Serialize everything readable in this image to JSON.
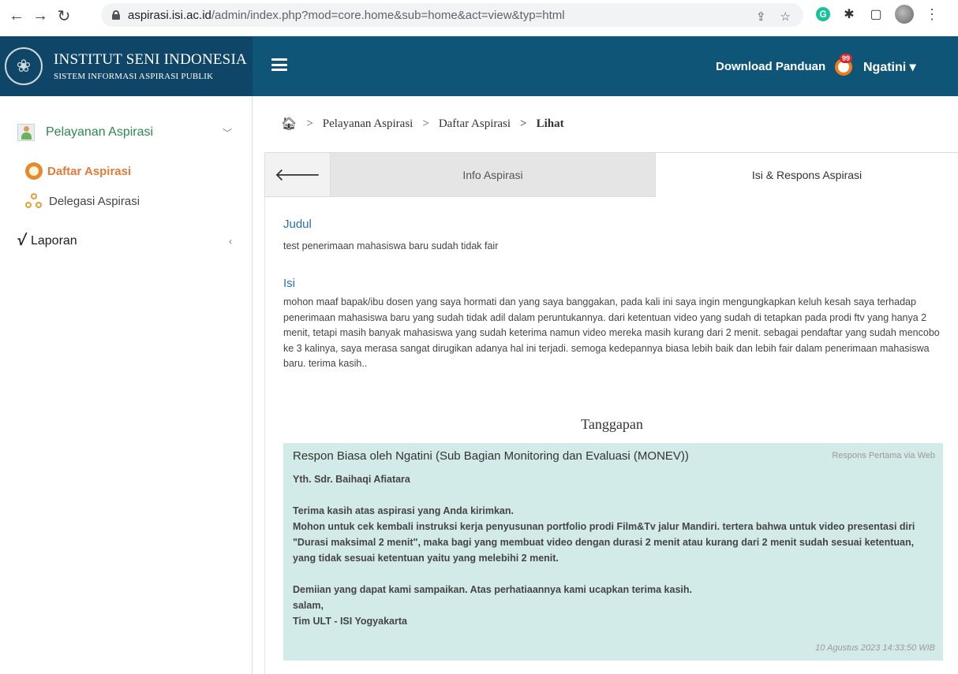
{
  "browser": {
    "url_host": "aspirasi.isi.ac.id",
    "url_path": "/admin/index.php?mod=core.home&sub=home&act=view&typ=html",
    "icons": [
      "back-icon",
      "forward-icon",
      "reload-icon",
      "lock-icon",
      "share-icon",
      "star-icon",
      "grammarly-icon",
      "extensions-icon",
      "sidepanel-icon",
      "profile-avatar",
      "menu-icon"
    ]
  },
  "brand": {
    "title": "INSTITUT SENI INDONESIA",
    "subtitle": "SISTEM INFORMASI ASPIRASI PUBLIK"
  },
  "topbar": {
    "download_label": "Download Panduan",
    "notif_count": "99",
    "user_name": "Ngatini ▾"
  },
  "sidebar": {
    "group1": "Pelayanan Aspirasi",
    "item_active": "Daftar Aspirasi",
    "item2": "Delegasi Aspirasi",
    "group2": "Laporan"
  },
  "breadcrumb": {
    "item1": "Pelayanan Aspirasi",
    "item2": "Daftar Aspirasi",
    "current": "Lihat"
  },
  "tabs": {
    "info": "Info Aspirasi",
    "isi": "Isi & Respons Aspirasi"
  },
  "aspirasi": {
    "judul_label": "Judul",
    "judul": "test penerimaan mahasiswa baru sudah tidak fair",
    "isi_label": "Isi",
    "isi": "mohon maaf bapak/ibu dosen yang saya hormati dan yang saya banggakan, pada kali ini saya ingin mengungkapkan keluh kesah saya terhadap penerimaan mahasiswa baru yang sudah tidak adil dalam peruntukannya. dari ketentuan video yang sudah di tetapkan pada prodi ftv yang hanya 2 menit, tetapi masih banyak mahasiswa yang sudah keterima namun video mereka masih kurang dari 2 menit. sebagai pendaftar yang sudah mencobo ke 3 kalinya, saya merasa sangat dirugikan adanya hal ini terjadi. semoga kedepannya biasa lebih baik dan lebih fair dalam penerimaan mahasiswa baru. terima kasih.."
  },
  "tanggapan": {
    "heading": "Tanggapan",
    "title": "Respon Biasa oleh Ngatini (Sub Bagian Monitoring dan Evaluasi (MONEV))",
    "via": "Respons Pertama via Web",
    "lines": [
      "Yth. Sdr. Baihaqi Afiatara",
      "",
      "Terima kasih atas aspirasi yang Anda kirimkan.",
      "Mohon untuk cek kembali instruksi kerja penyusunan portfolio prodi Film&Tv jalur Mandiri. tertera bahwa untuk video presentasi diri \"Durasi maksimal 2 menit\", maka bagi yang membuat video dengan durasi 2 menit atau kurang dari 2 menit sudah sesuai ketentuan, yang tidak sesuai ketentuan yaitu yang melebihi 2 menit.",
      "",
      "Demiian yang dapat kami sampaikan. Atas perhatiaannya kami ucapkan terima kasih.",
      "salam,",
      "Tim ULT - ISI Yogyakarta"
    ],
    "date": "10 Agustus 2023 14:33:50 WIB"
  }
}
